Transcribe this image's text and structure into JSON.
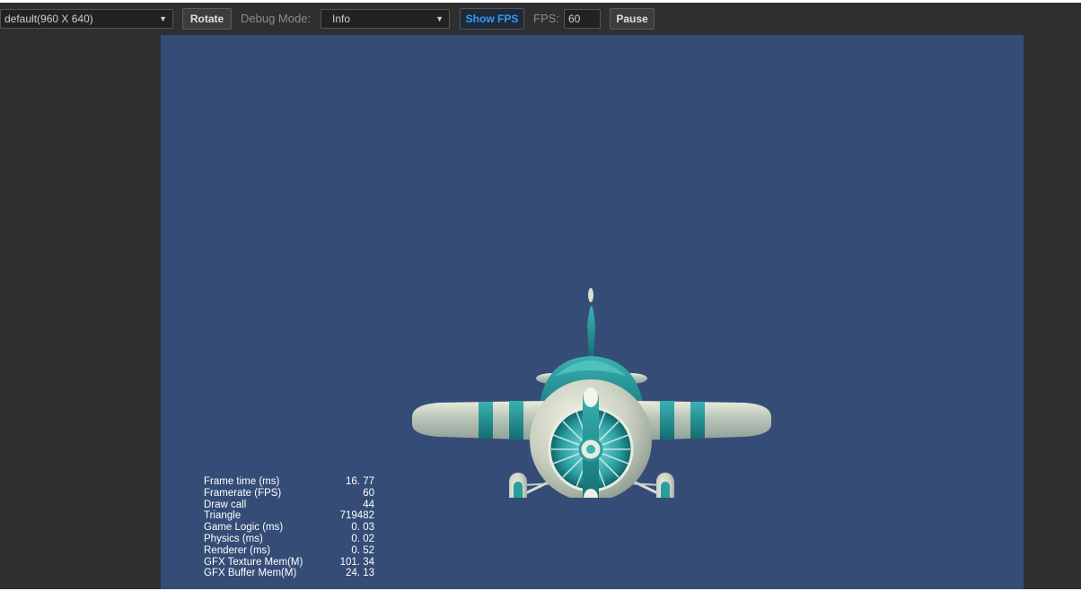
{
  "toolbar": {
    "resolution": {
      "value": "default(960 X 640)"
    },
    "rotate_label": "Rotate",
    "debug_mode_label": "Debug Mode:",
    "debug_mode": {
      "value": "Info"
    },
    "show_fps_label": "Show FPS",
    "fps_label": "FPS:",
    "fps_value": "60",
    "pause_label": "Pause"
  },
  "colors": {
    "viewport_bg": "#354c77",
    "accent": "#2e9bff",
    "plane_teal": "#1f8e8f",
    "plane_cream": "#d9dccb"
  },
  "stats": [
    {
      "label": "Frame time (ms)",
      "value": "16. 77"
    },
    {
      "label": "Framerate (FPS)",
      "value": "60"
    },
    {
      "label": "Draw call",
      "value": "44"
    },
    {
      "label": "Triangle",
      "value": "719482"
    },
    {
      "label": "Game Logic (ms)",
      "value": "0. 03"
    },
    {
      "label": "Physics (ms)",
      "value": "0. 02"
    },
    {
      "label": "Renderer (ms)",
      "value": "0. 52"
    },
    {
      "label": "GFX Texture Mem(M)",
      "value": "101. 34"
    },
    {
      "label": "GFX Buffer Mem(M)",
      "value": "24. 13"
    }
  ]
}
